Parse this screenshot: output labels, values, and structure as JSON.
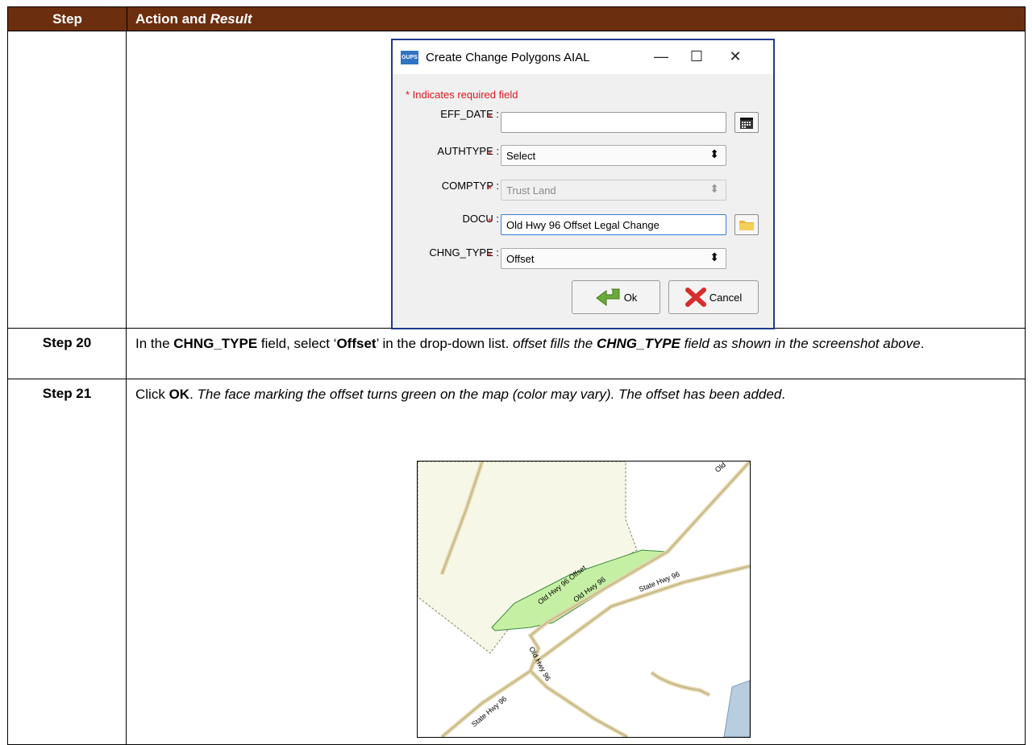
{
  "table": {
    "header": {
      "step": "Step",
      "action_prefix": "Action and ",
      "action_italic": "Result"
    },
    "rows": [
      {
        "step": "",
        "dialog": {
          "app_icon_text": "GUPS",
          "title": "Create Change Polygons AIAL",
          "minimize": "—",
          "maximize": "☐",
          "close": "✕",
          "required_note": "* Indicates required field",
          "fields": [
            {
              "label": "EFF_DATE :",
              "value": "",
              "kind": "text-with-calendar"
            },
            {
              "label": "AUTHTYPE :",
              "value": "Select",
              "kind": "select"
            },
            {
              "label": "COMPTYP :",
              "value": "Trust Land",
              "kind": "select-disabled"
            },
            {
              "label": "DOCU :",
              "value": "Old Hwy 96 Offset Legal Change",
              "kind": "text-with-folder"
            },
            {
              "label": "CHNG_TYPE :",
              "value": "Offset",
              "kind": "select"
            }
          ],
          "required_star": "*",
          "ok_label": "Ok",
          "cancel_label": "Cancel"
        }
      },
      {
        "step": "Step 20",
        "text": {
          "p1": "In the ",
          "b1": "CHNG_TYPE",
          "p2": " field, select ‘",
          "b2": "Offset",
          "p3": "’ in the drop-down list. ",
          "i1": "offset fills the ",
          "bi1": "CHNG_TYPE",
          "i2": " field as shown in the screenshot above",
          "end": "."
        }
      },
      {
        "step": "Step 21",
        "text": {
          "p1": "Click ",
          "b1": "OK",
          "p2": ". ",
          "i1": "The face marking the offset turns green on the map (color may vary). The offset has been added",
          "end": "."
        },
        "map": {
          "labels": [
            "Old Hwy 96 Offset",
            "Old Hwy 96",
            "State Hwy 96",
            "Old Hwy 96",
            "State Hwy 96",
            "Old"
          ],
          "colors": {
            "offset_face": "#c5f0a4",
            "land": "#f7f7e7",
            "water": "#b9cde0",
            "road": "#e8dcb5"
          }
        }
      }
    ]
  }
}
